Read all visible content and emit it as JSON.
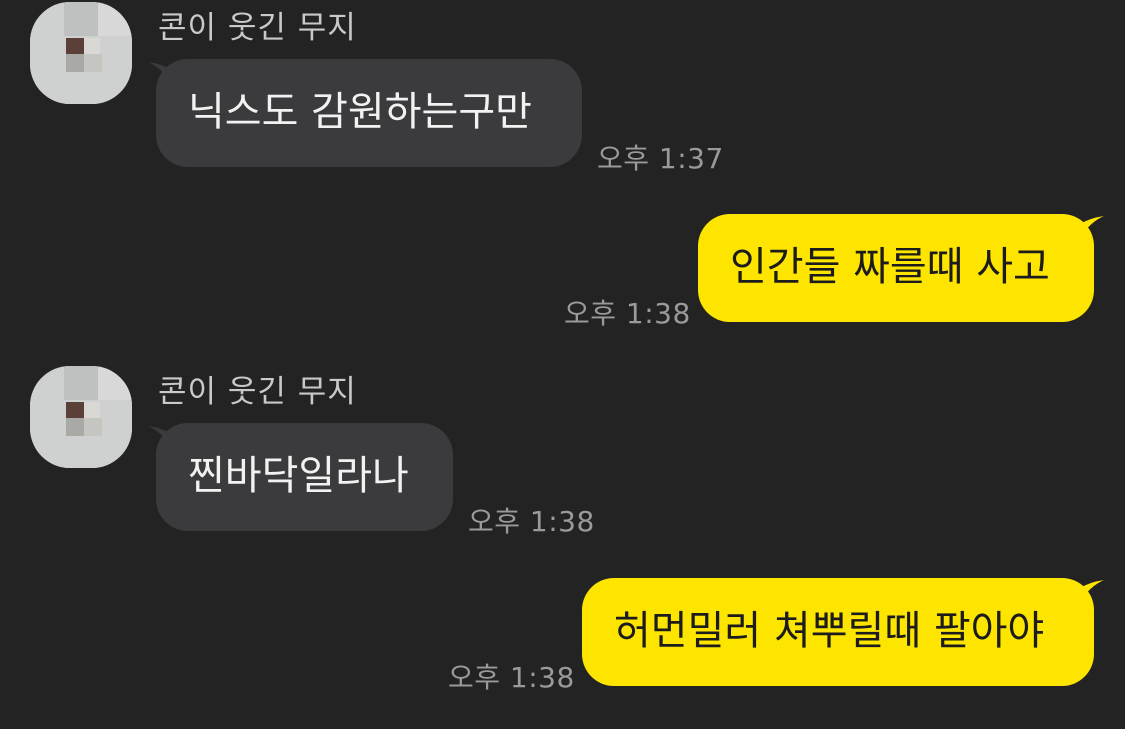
{
  "colors": {
    "background": "#232324",
    "incoming_bubble": "#3b3b3d",
    "outgoing_bubble": "#fee500",
    "sender_name": "#c9c9c9",
    "timestamp": "#9a9a9a"
  },
  "messages": [
    {
      "direction": "incoming",
      "sender": "콘이 웃긴 무지",
      "text": "닉스도 감원하는구만",
      "time": "오후 1:37",
      "avatar_icon": "pixelated-profile-icon"
    },
    {
      "direction": "outgoing",
      "text": "인간들 짜를때 사고",
      "time": "오후 1:38"
    },
    {
      "direction": "incoming",
      "sender": "콘이 웃긴 무지",
      "text": "찐바닥일라나",
      "time": "오후 1:38",
      "avatar_icon": "pixelated-profile-icon"
    },
    {
      "direction": "outgoing",
      "text": "허먼밀러 쳐뿌릴때 팔아야",
      "time": "오후 1:38"
    }
  ]
}
